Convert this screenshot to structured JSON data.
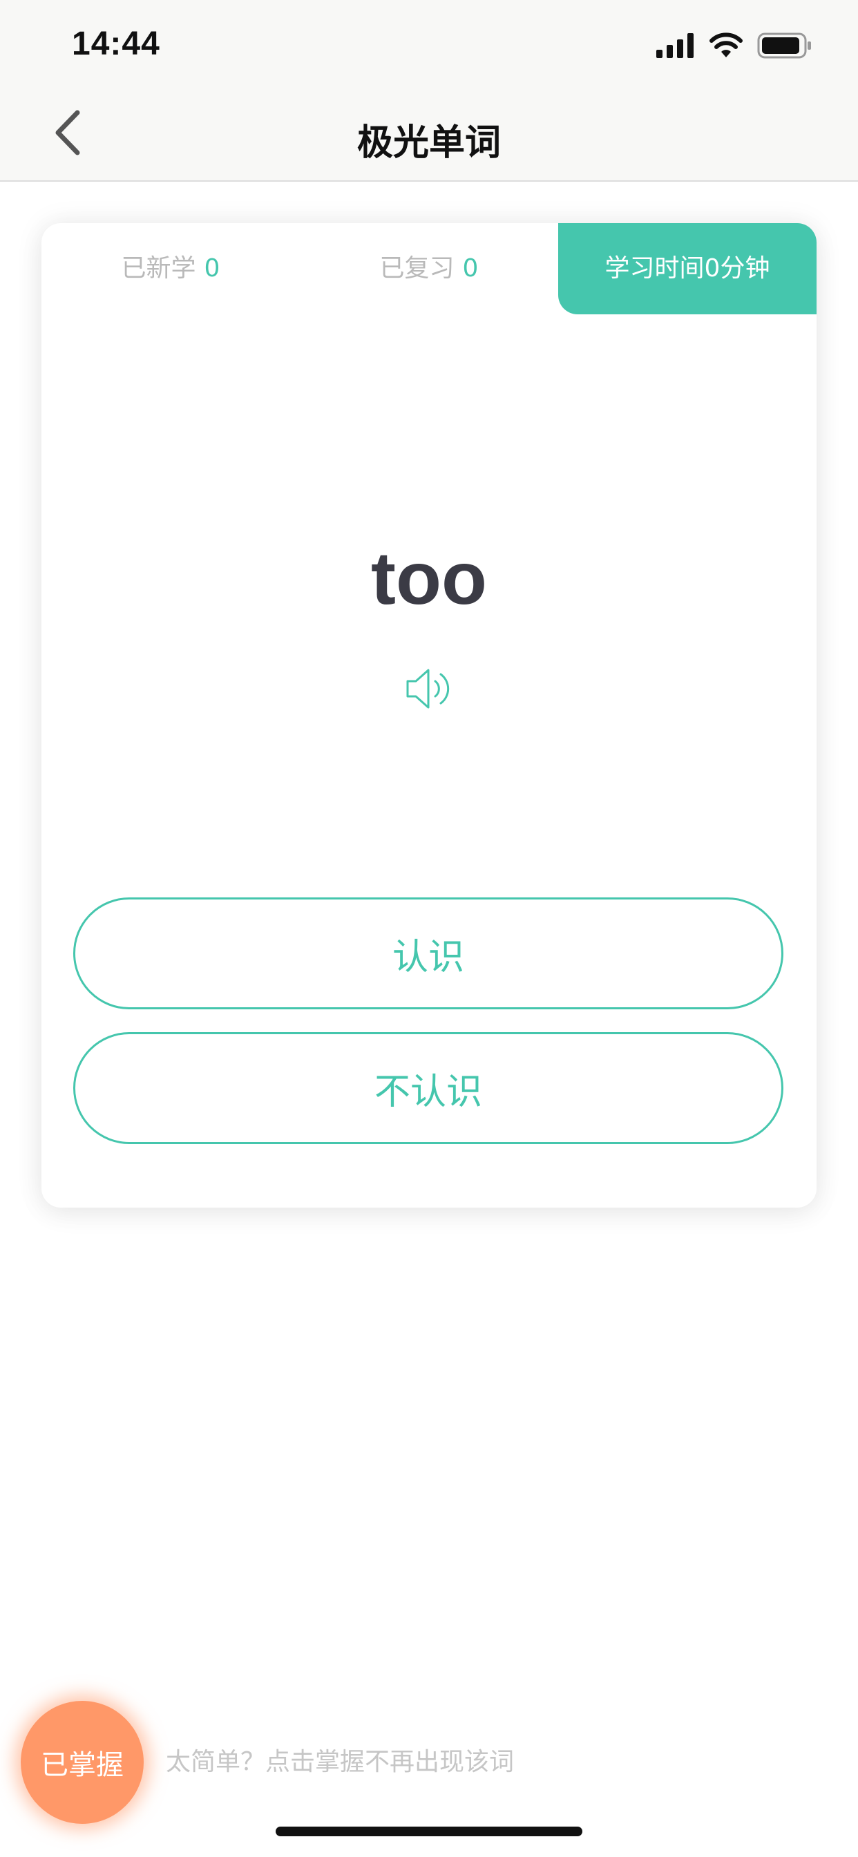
{
  "status_bar": {
    "time": "14:44",
    "icons": [
      "cellular-signal-icon",
      "wifi-icon",
      "battery-icon"
    ]
  },
  "nav": {
    "title": "极光单词",
    "back_icon": "chevron-left-icon"
  },
  "stats": {
    "new_label": "已新学",
    "new_value": "0",
    "review_label": "已复习",
    "review_value": "0",
    "study_time": "学习时间0分钟"
  },
  "word": {
    "text": "too",
    "pronounce_icon": "speaker-icon"
  },
  "actions": {
    "know_label": "认识",
    "dont_know_label": "不认识"
  },
  "bottom": {
    "mastered_label": "已掌握",
    "hint": "太简单？点击掌握不再出现该词"
  },
  "colors": {
    "accent": "#45c6ad",
    "orange": "#ff9868",
    "word_text": "#3b3b45",
    "muted_text": "#b9b9b9"
  }
}
